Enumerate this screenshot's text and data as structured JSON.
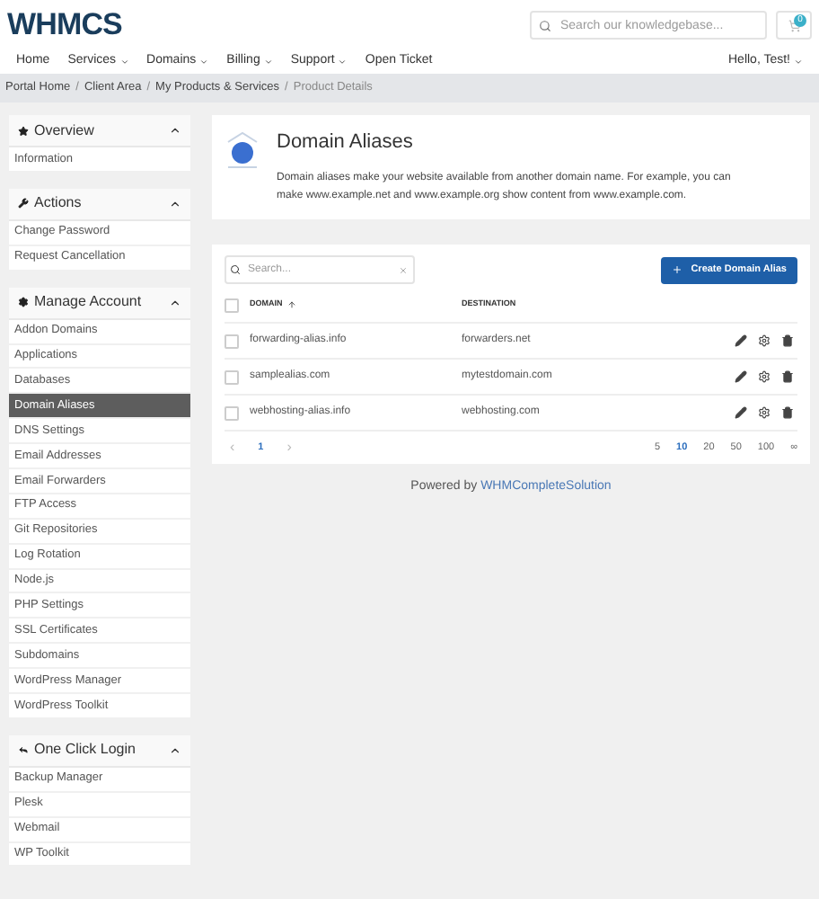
{
  "header": {
    "logo": "WHMCS",
    "search": {
      "placeholder": "Search our knowledgebase..."
    },
    "cart_count": "0"
  },
  "nav": {
    "items": [
      {
        "label": "Home",
        "dropdown": false
      },
      {
        "label": "Services",
        "dropdown": true
      },
      {
        "label": "Domains",
        "dropdown": true
      },
      {
        "label": "Billing",
        "dropdown": true
      },
      {
        "label": "Support",
        "dropdown": true
      },
      {
        "label": "Open Ticket",
        "dropdown": false
      }
    ],
    "user": "Hello, Test!"
  },
  "breadcrumb": {
    "separator": "/",
    "items": [
      "Portal Home",
      "Client Area",
      "My Products & Services",
      "Product Details"
    ]
  },
  "sidebar": [
    {
      "title": "Overview",
      "expanded": true,
      "items": [
        {
          "label": "Information",
          "selected": false
        }
      ]
    },
    {
      "title": "Actions",
      "expanded": true,
      "items": [
        {
          "label": "Change Password",
          "selected": false
        },
        {
          "label": "Request Cancellation",
          "selected": false
        }
      ]
    },
    {
      "title": "Manage Account",
      "expanded": true,
      "items": [
        {
          "label": "Addon Domains",
          "selected": false
        },
        {
          "label": "Applications",
          "selected": false
        },
        {
          "label": "Databases",
          "selected": false
        },
        {
          "label": "Domain Aliases",
          "selected": true
        },
        {
          "label": "DNS Settings",
          "selected": false
        },
        {
          "label": "Email Addresses",
          "selected": false
        },
        {
          "label": "Email Forwarders",
          "selected": false
        },
        {
          "label": "FTP Access",
          "selected": false
        },
        {
          "label": "Git Repositories",
          "selected": false
        },
        {
          "label": "Log Rotation",
          "selected": false
        },
        {
          "label": "Node.js",
          "selected": false
        },
        {
          "label": "PHP Settings",
          "selected": false
        },
        {
          "label": "SSL Certificates",
          "selected": false
        },
        {
          "label": "Subdomains",
          "selected": false
        },
        {
          "label": "WordPress Manager",
          "selected": false
        },
        {
          "label": "WordPress Toolkit",
          "selected": false
        }
      ]
    },
    {
      "title": "One Click Login",
      "expanded": true,
      "items": [
        {
          "label": "Backup Manager",
          "selected": false
        },
        {
          "label": "Plesk",
          "selected": false
        },
        {
          "label": "Webmail",
          "selected": false
        },
        {
          "label": "WP Toolkit",
          "selected": false
        }
      ]
    }
  ],
  "intro": {
    "title": "Domain Aliases",
    "description": "Domain aliases make your website available from another domain name. For example, you can make www.example.net and www.example.org show content from www.example.com."
  },
  "table": {
    "search": {
      "placeholder": "Search..."
    },
    "create_button": "Create Domain Alias",
    "select_all": {
      "checked": false
    },
    "columns": [
      {
        "label": "DOMAIN",
        "sorted": true
      },
      {
        "label": "DESTINATION",
        "sorted": false
      }
    ],
    "rows": [
      {
        "domain": "forwarding-alias.info",
        "destination": "forwarders.net",
        "checked": false
      },
      {
        "domain": "samplealias.com",
        "destination": "mytestdomain.com",
        "checked": false
      },
      {
        "domain": "webhosting-alias.info",
        "destination": "webhosting.com",
        "checked": false
      }
    ],
    "pagination": {
      "prev": "‹",
      "pages": [
        {
          "label": "1",
          "selected": true
        }
      ],
      "next": "›"
    },
    "page_sizes": [
      {
        "label": "5",
        "selected": false
      },
      {
        "label": "10",
        "selected": true
      },
      {
        "label": "20",
        "selected": false
      },
      {
        "label": "50",
        "selected": false
      },
      {
        "label": "100",
        "selected": false
      },
      {
        "label": "∞",
        "selected": false
      }
    ]
  },
  "footer": {
    "text": "Powered by",
    "link": "WHMCompleteSolution"
  }
}
